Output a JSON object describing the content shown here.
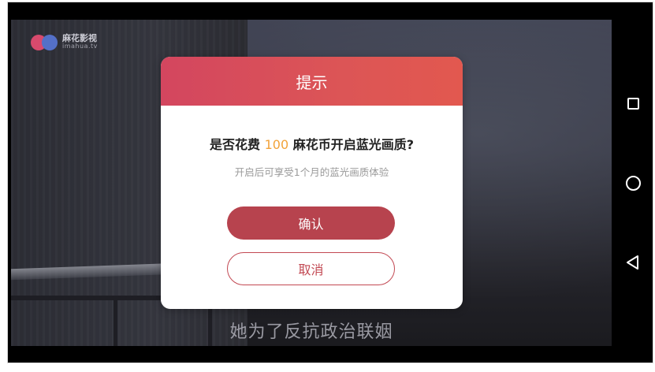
{
  "video": {
    "logo_brand": "麻花影视",
    "logo_domain": "imahua.tv",
    "subtitle": "她为了反抗政治联姻"
  },
  "dialog": {
    "title": "提示",
    "question_prefix": "是否花费",
    "question_amount": "100",
    "question_suffix": "麻花币开启蓝光画质?",
    "note": "开启后可享受1个月的蓝光画质体验",
    "confirm_label": "确认",
    "cancel_label": "取消"
  },
  "navbar": {
    "icons": [
      "recent-apps-icon",
      "home-icon",
      "back-icon"
    ]
  },
  "colors": {
    "header_start": "#d3465f",
    "header_end": "#e2584f",
    "amount": "#f2a33a",
    "confirm_bg": "#b7434e",
    "cancel_border": "#c24852"
  }
}
